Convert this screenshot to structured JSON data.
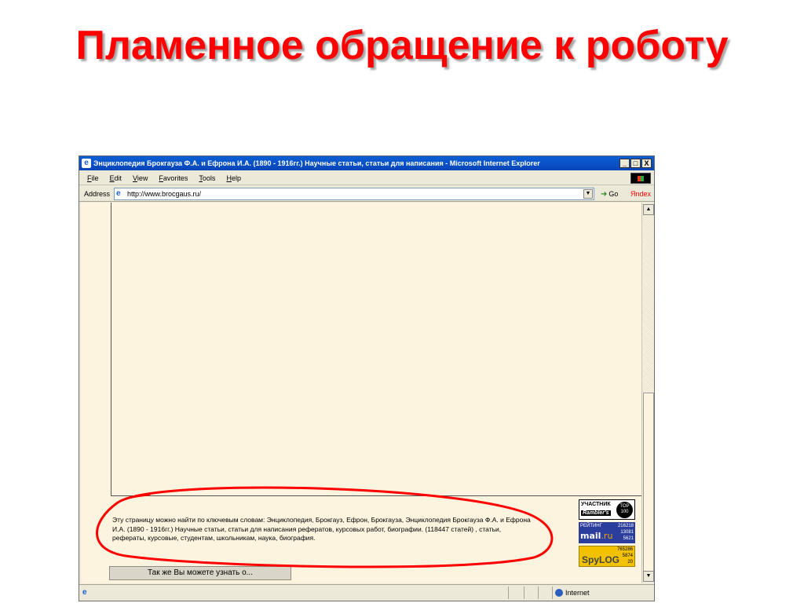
{
  "slide": {
    "title": "Пламенное обращение к роботу"
  },
  "window": {
    "title": "Энциклопедия Брокгауза Ф.А. и Ефрона И.А. (1890 - 1916гг.) Научные статьи, статьи для написания - Microsoft Internet Explorer",
    "buttons": {
      "minimize": "_",
      "maximize": "□",
      "close": "X"
    }
  },
  "menu": [
    "File",
    "Edit",
    "View",
    "Favorites",
    "Tools",
    "Help"
  ],
  "address": {
    "label": "Address",
    "url": "http://www.brocgaus.ru/",
    "go_label": "Go",
    "links_label": "Яndex"
  },
  "page": {
    "keywords_text": "Эту страницу можно найти по ключевым словам: Энциклопедия, Брокгауз, Ефрон, Брокгауза, Энциклопедия Брокгауза Ф.А. и Ефрона И.А. (1890 - 1916гг.) Научные статьи, статьи для написания рефератов, курсовых работ, биографии. (118447 статей) , статьи, рефераты, курсовые, студентам, школьникам, наука, биография.",
    "also_button": "Так же Вы можете узнать о...",
    "counters": {
      "rambler": {
        "top_text": "УЧАСТНИК",
        "name": "Rambler's",
        "badge": "TOP 100"
      },
      "mail": {
        "rating_label": "РЕЙТИНГ",
        "logo": "mail",
        "logo_suffix": ".ru",
        "n1": "216218",
        "n2": "13081",
        "n3": "5621"
      },
      "spylog": {
        "logo": "SpyLOG",
        "n1": "765286",
        "n2": "5874",
        "n3": "20"
      }
    }
  },
  "status": {
    "zone": "Internet"
  },
  "colors": {
    "title_red": "#ff0000",
    "titlebar_blue": "#0a5fd6",
    "page_background": "#fdf4df",
    "annotation_red": "#ff0000"
  }
}
